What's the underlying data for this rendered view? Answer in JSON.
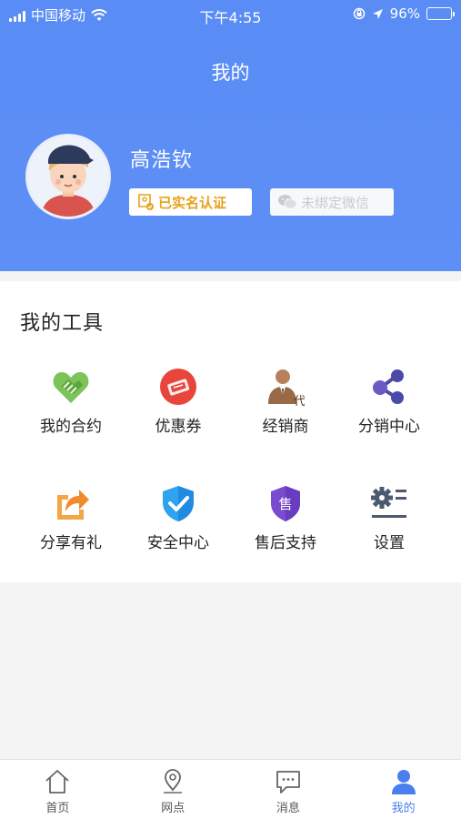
{
  "status_bar": {
    "carrier": "中国移动",
    "time": "下午4:55",
    "battery": "96%",
    "battery_level": 0.96
  },
  "header": {
    "title": "我的"
  },
  "profile": {
    "name": "高浩钦",
    "verified_label": "已实名认证",
    "wechat_label": "未绑定微信"
  },
  "tools": {
    "title": "我的工具",
    "items": [
      {
        "label": "我的合约",
        "icon": "handshake-icon"
      },
      {
        "label": "优惠券",
        "icon": "coupon-icon"
      },
      {
        "label": "经销商",
        "icon": "dealer-icon"
      },
      {
        "label": "分销中心",
        "icon": "share-nodes-icon"
      },
      {
        "label": "分享有礼",
        "icon": "share-arrow-icon"
      },
      {
        "label": "安全中心",
        "icon": "shield-check-icon"
      },
      {
        "label": "售后支持",
        "icon": "aftersales-shield-icon"
      },
      {
        "label": "设置",
        "icon": "gear-icon"
      }
    ]
  },
  "tabbar": {
    "items": [
      {
        "label": "首页",
        "icon": "home-icon"
      },
      {
        "label": "网点",
        "icon": "location-pin-icon"
      },
      {
        "label": "消息",
        "icon": "chat-bubble-icon"
      },
      {
        "label": "我的",
        "icon": "user-icon",
        "active": true
      }
    ]
  },
  "colors": {
    "primary": "#5a8cf5",
    "badge_gold": "#e7a21a",
    "active_tab": "#4a7ff0"
  }
}
